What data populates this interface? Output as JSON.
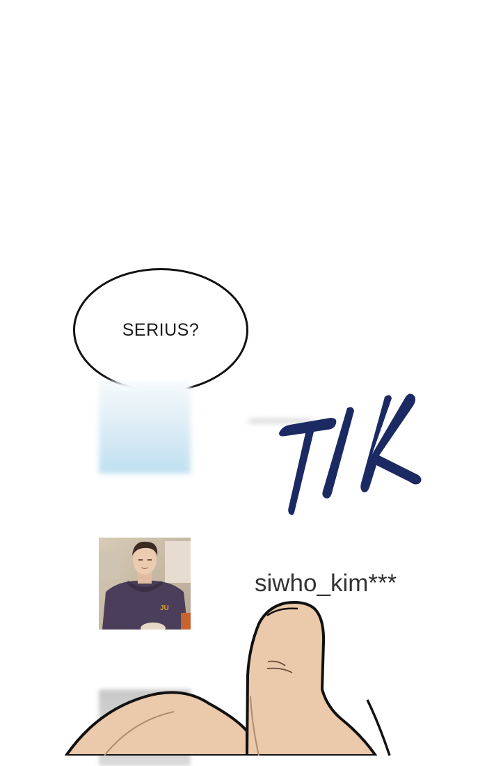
{
  "speech_bubble": {
    "text": "SERIUS?"
  },
  "sound_effect": {
    "text": "TIK",
    "color": "#1b2a63"
  },
  "profile": {
    "username": "siwho_kim***",
    "hoodie_text": "JU"
  },
  "colors": {
    "skin": "#e9c7a8",
    "outline": "#111111",
    "hoodie": "#4a3e5a"
  }
}
